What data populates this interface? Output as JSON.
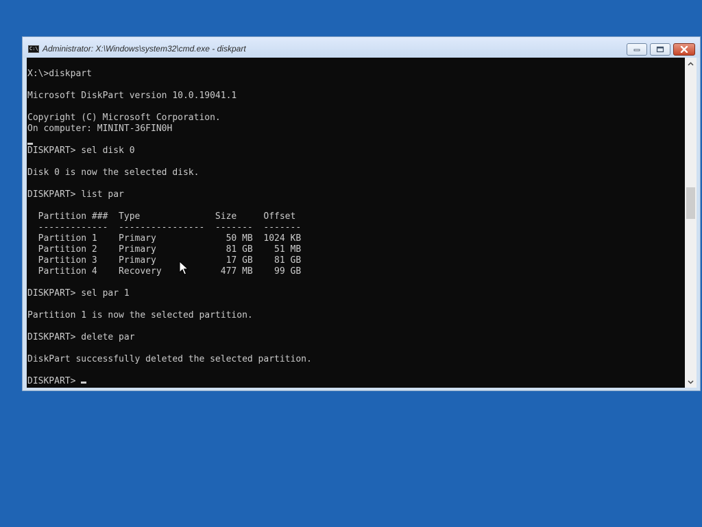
{
  "window": {
    "title": "Administrator: X:\\Windows\\system32\\cmd.exe - diskpart",
    "icon": "cmd-icon",
    "icon_text": "C:\\"
  },
  "controls": {
    "minimize_icon": "minimize-icon",
    "maximize_icon": "maximize-icon",
    "close_icon": "close-icon"
  },
  "console": {
    "background": "#0c0c0c",
    "foreground": "#cccccc",
    "lines": [
      "X:\\>diskpart",
      "",
      "Microsoft DiskPart version 10.0.19041.1",
      "",
      "Copyright (C) Microsoft Corporation.",
      "On computer: MININT-36FIN0H",
      "",
      "DISKPART> sel disk 0",
      "",
      "Disk 0 is now the selected disk.",
      "",
      "DISKPART> list par",
      "",
      "  Partition ###  Type              Size     Offset",
      "  -------------  ----------------  -------  -------",
      "  Partition 1    Primary             50 MB  1024 KB",
      "  Partition 2    Primary             81 GB    51 MB",
      "  Partition 3    Primary             17 GB    81 GB",
      "  Partition 4    Recovery           477 MB    99 GB",
      "",
      "DISKPART> sel par 1",
      "",
      "Partition 1 is now the selected partition.",
      "",
      "DISKPART> delete par",
      "",
      "DiskPart successfully deleted the selected partition.",
      "",
      "DISKPART> "
    ]
  },
  "scrollbar": {
    "up_icon": "scroll-up-arrow-icon",
    "down_icon": "scroll-down-arrow-icon"
  },
  "colors": {
    "desktop": "#1f64b4",
    "window_frame": "#cfe0f2",
    "close_button": "#c7472a"
  }
}
